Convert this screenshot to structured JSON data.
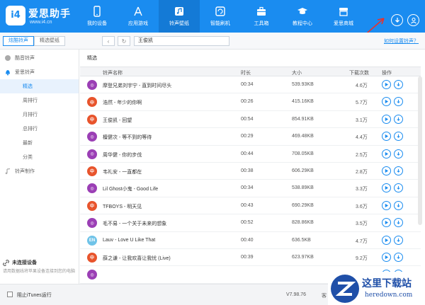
{
  "header": {
    "logo_badge": "i4",
    "logo_name": "爱思助手",
    "logo_url": "www.i4.cn",
    "nav": [
      {
        "label": "我的设备",
        "icon": "phone-icon"
      },
      {
        "label": "应用游戏",
        "icon": "app-store-icon"
      },
      {
        "label": "铃声壁纸",
        "icon": "music-note-icon"
      },
      {
        "label": "智能刷机",
        "icon": "refresh-icon"
      },
      {
        "label": "工具箱",
        "icon": "toolbox-icon"
      },
      {
        "label": "教程中心",
        "icon": "graduation-cap-icon"
      },
      {
        "label": "爱思商城",
        "icon": "shop-icon"
      }
    ],
    "active_nav": 2
  },
  "toolbar": {
    "tabs": [
      "炫酷铃声",
      "精选壁纸"
    ],
    "search_value": "王俊凯",
    "help_link": "如何设置铃声？"
  },
  "sidebar": {
    "items": [
      {
        "label": "酷音铃声",
        "type": "parent",
        "icon": "ringtone-icon"
      },
      {
        "label": "爱思铃声",
        "type": "parent",
        "icon": "bell-icon"
      },
      {
        "label": "精选",
        "type": "child",
        "active": true
      },
      {
        "label": "周排行",
        "type": "child"
      },
      {
        "label": "月排行",
        "type": "child"
      },
      {
        "label": "总排行",
        "type": "child"
      },
      {
        "label": "最新",
        "type": "child"
      },
      {
        "label": "分类",
        "type": "child"
      },
      {
        "label": "铃声制作",
        "type": "parent",
        "icon": "music-make-icon"
      }
    ],
    "not_connected_title": "未连接设备",
    "not_connected_desc": "请用数据线将苹果设备连接到您的电脑"
  },
  "main": {
    "title": "精选",
    "columns": {
      "name": "铃声名称",
      "duration": "时长",
      "size": "大小",
      "downloads": "下载次数",
      "ops": "操作"
    },
    "rows": [
      {
        "name": "摩登兄弟刘宇宁 - 直到时间尽头",
        "duration": "00:34",
        "size": "539.93KB",
        "downloads": "4.6万",
        "badge": "◎",
        "color": "#9b3fb5"
      },
      {
        "name": "浩然 - 年少的你啊",
        "duration": "00:26",
        "size": "415.16KB",
        "downloads": "5.7万",
        "badge": "中",
        "color": "#e8542c"
      },
      {
        "name": "王俊凯 - 回望",
        "duration": "00:54",
        "size": "854.91KB",
        "downloads": "3.1万",
        "badge": "中",
        "color": "#e8542c"
      },
      {
        "name": "檀健次 - 等不到的等待",
        "duration": "00:29",
        "size": "469.48KB",
        "downloads": "4.4万",
        "badge": "◎",
        "color": "#9b3fb5"
      },
      {
        "name": "周华健 - 你的步伐",
        "duration": "00:44",
        "size": "708.05KB",
        "downloads": "2.5万",
        "badge": "◎",
        "color": "#9b3fb5"
      },
      {
        "name": "韦礼安 - 一直都在",
        "duration": "00:38",
        "size": "606.29KB",
        "downloads": "2.8万",
        "badge": "中",
        "color": "#e8542c"
      },
      {
        "name": "Lil Ghost小鬼 - Good Life",
        "duration": "00:34",
        "size": "538.89KB",
        "downloads": "3.3万",
        "badge": "◎",
        "color": "#9b3fb5"
      },
      {
        "name": "TFBOYS - 明天见",
        "duration": "00:43",
        "size": "690.29KB",
        "downloads": "3.6万",
        "badge": "中",
        "color": "#e8542c"
      },
      {
        "name": "毛不易 - 一个关于未来的想象",
        "duration": "00:52",
        "size": "828.86KB",
        "downloads": "3.5万",
        "badge": "◎",
        "color": "#9b3fb5"
      },
      {
        "name": "Lauv - Love U Like That",
        "duration": "00:40",
        "size": "636.5KB",
        "downloads": "4.7万",
        "badge": "EN",
        "color": "#6fc3e8"
      },
      {
        "name": "薛之谦 - 让我欢喜让我忧 (Live)",
        "duration": "00:39",
        "size": "623.97KB",
        "downloads": "9.2万",
        "badge": "中",
        "color": "#e8542c"
      },
      {
        "name": "",
        "duration": "",
        "size": "",
        "downloads": "",
        "badge": "◎",
        "color": "#9b3fb5"
      }
    ]
  },
  "footer": {
    "checkbox_label": "阻止iTunes运行",
    "version": "V7.98.76",
    "text": "客"
  },
  "watermark": {
    "title": "这里下载站",
    "url": "heredown.com"
  }
}
